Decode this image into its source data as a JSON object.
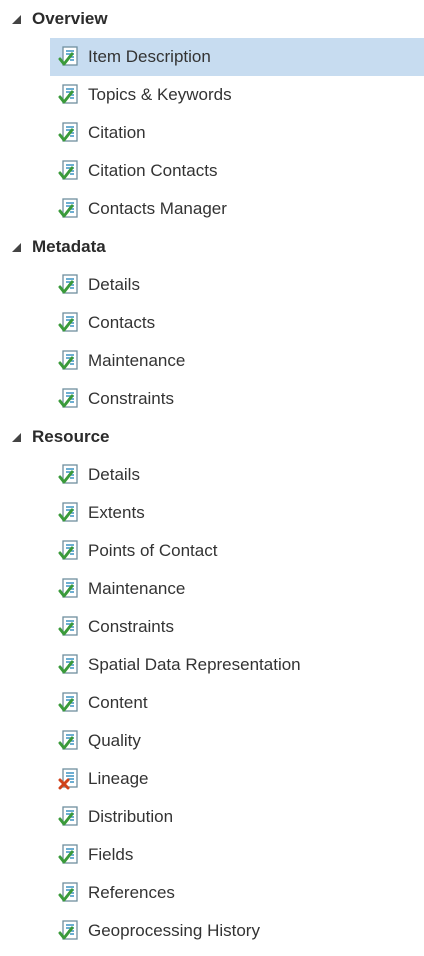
{
  "tree": {
    "groups": [
      {
        "title": "Overview",
        "items": [
          {
            "label": "Item Description",
            "status": "check-icon",
            "selected": true
          },
          {
            "label": "Topics & Keywords",
            "status": "check-icon"
          },
          {
            "label": "Citation",
            "status": "check-icon"
          },
          {
            "label": "Citation Contacts",
            "status": "check-icon"
          },
          {
            "label": "Contacts Manager",
            "status": "check-icon"
          }
        ]
      },
      {
        "title": "Metadata",
        "items": [
          {
            "label": "Details",
            "status": "check-icon"
          },
          {
            "label": "Contacts",
            "status": "check-icon"
          },
          {
            "label": "Maintenance",
            "status": "check-icon"
          },
          {
            "label": "Constraints",
            "status": "check-icon"
          }
        ]
      },
      {
        "title": "Resource",
        "items": [
          {
            "label": "Details",
            "status": "check-icon"
          },
          {
            "label": "Extents",
            "status": "check-icon"
          },
          {
            "label": "Points of Contact",
            "status": "check-icon"
          },
          {
            "label": "Maintenance",
            "status": "check-icon"
          },
          {
            "label": "Constraints",
            "status": "check-icon"
          },
          {
            "label": "Spatial Data Representation",
            "status": "check-icon"
          },
          {
            "label": "Content",
            "status": "check-icon"
          },
          {
            "label": "Quality",
            "status": "check-icon"
          },
          {
            "label": "Lineage",
            "status": "error-x-icon"
          },
          {
            "label": "Distribution",
            "status": "check-icon"
          },
          {
            "label": "Fields",
            "status": "check-icon"
          },
          {
            "label": "References",
            "status": "check-icon"
          },
          {
            "label": "Geoprocessing History",
            "status": "check-icon"
          }
        ]
      }
    ]
  },
  "colors": {
    "selected_bg": "#c7dcf0",
    "check_green": "#3a9a3a",
    "error_red": "#d0421b",
    "doc_border": "#6f8f9f",
    "doc_lines": "#2e8bbf"
  }
}
